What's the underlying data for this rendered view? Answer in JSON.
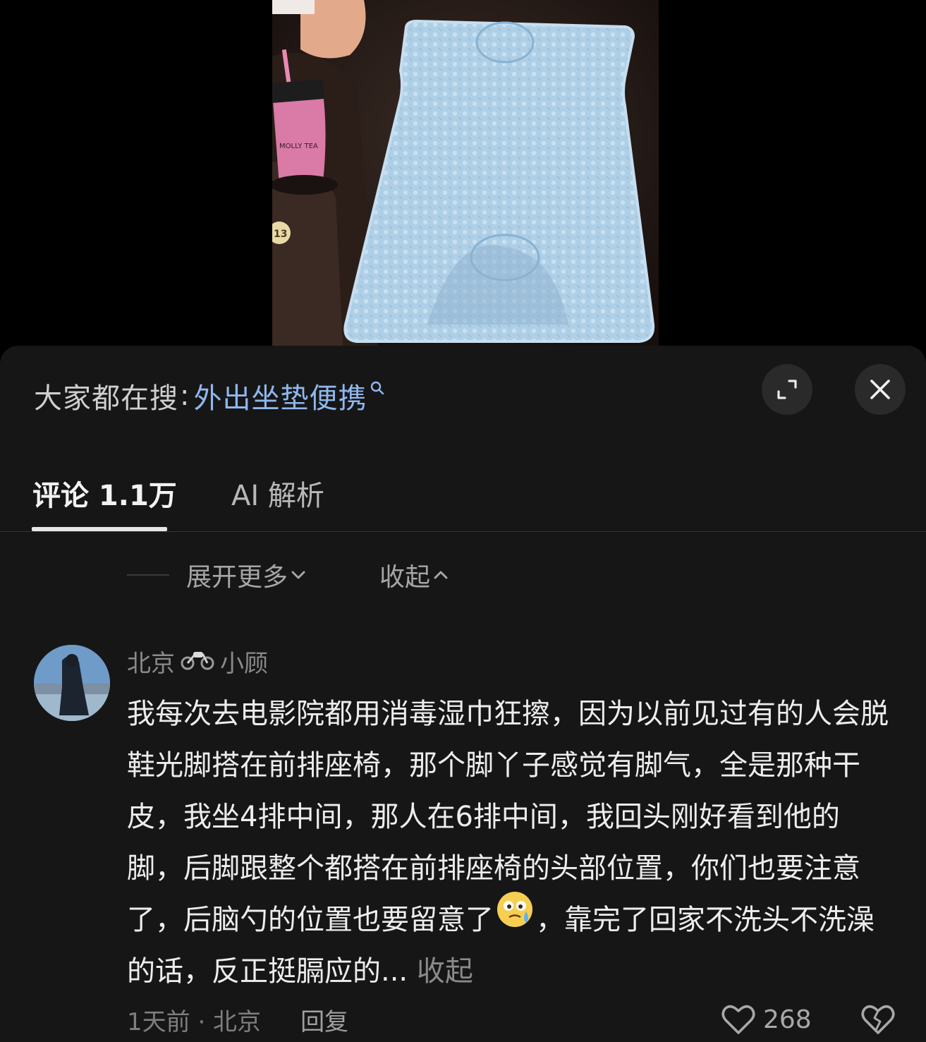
{
  "search": {
    "prefix": "大家都在搜",
    "colon": ":",
    "term": "外出坐垫便携",
    "term_icon": "search-icon"
  },
  "header_buttons": {
    "expand_icon": "expand-icon",
    "close_icon": "close-icon"
  },
  "tabs": [
    {
      "label": "评论 1.1万",
      "active": true
    },
    {
      "label": "AI 解析",
      "active": false
    }
  ],
  "reply_controls": {
    "expand_more": "展开更多",
    "collapse": "收起"
  },
  "comment": {
    "author_location": "北京",
    "author_badge_icon": "motorcycle-icon",
    "author_name": "小顾",
    "body_before_emoji": "我每次去电影院都用消毒湿巾狂擦，因为以前见过有的人会脱鞋光脚搭在前排座椅，那个脚丫子感觉有脚气，全是那种干皮，我坐4排中间，那人在6排中间，我回头刚好看到他的脚，后脚跟整个都搭在前排座椅的头部位置，你们也要注意了，后脑勺的位置也要留意了",
    "emoji_icon": "teary-face-emoji-icon",
    "body_after_emoji": "，靠完了回家不洗头不洗澡的话，反正挺膈应的...",
    "collapse_link": "收起",
    "time_location": "1天前 · 北京",
    "reply_label": "回复",
    "like_count": "268"
  },
  "colors": {
    "sheet_bg": "#161616",
    "link_blue": "#8fb7ee",
    "text_primary": "#ededed",
    "text_muted": "#8a8a8a"
  }
}
